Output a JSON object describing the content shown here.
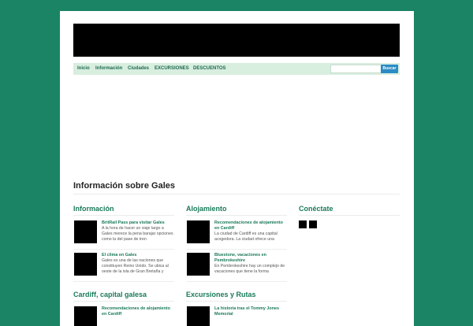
{
  "nav": {
    "items": [
      "Inicio",
      "Información",
      "Ciudades",
      "EXCURSIONES",
      "DESCUENTOS"
    ],
    "search_placeholder": "",
    "search_button": "Buscar"
  },
  "main": {
    "title": "Información sobre Gales"
  },
  "sections": {
    "informacion": {
      "title": "Información",
      "posts": [
        {
          "title": "BritRail Pass para visitar Gales",
          "excerpt": "A la hora de hacer un viaje largo a Gales merece la pena barajar opciones como la del pase de tren"
        },
        {
          "title": "El clima en Gales",
          "excerpt": "Gales es una de las naciones que constituyen Reino Unido. Se ubica al oeste de la isla de Gran Bretaña y"
        }
      ]
    },
    "alojamiento": {
      "title": "Alojamiento",
      "posts": [
        {
          "title": "Recomendaciones de alojamiento en Cardiff",
          "excerpt": "La ciudad de Cardiff es una capital acogedora. La ciudad ofrece una"
        },
        {
          "title": "Bluestone, vacaciones en Pembrokeshire",
          "excerpt": "En Pembrokeshire hay un complejo de vacaciones que tiene la forma"
        }
      ]
    },
    "conectate": {
      "title": "Conéctate",
      "icons": [
        "social-icon-1",
        "social-icon-2"
      ]
    },
    "cardiff": {
      "title": "Cardiff, capital galesa",
      "posts": [
        {
          "title": "Recomendaciones de alojamiento en Cardiff"
        }
      ]
    },
    "excursiones": {
      "title": "Excursiones y Rutas",
      "posts": [
        {
          "title": "La historia tras el Tommy Jones Memorial"
        }
      ]
    }
  },
  "colors": {
    "background": "#1a8464",
    "accent": "#1a7a5a",
    "nav_bg": "#d8eedf",
    "button": "#2b8bc4"
  }
}
